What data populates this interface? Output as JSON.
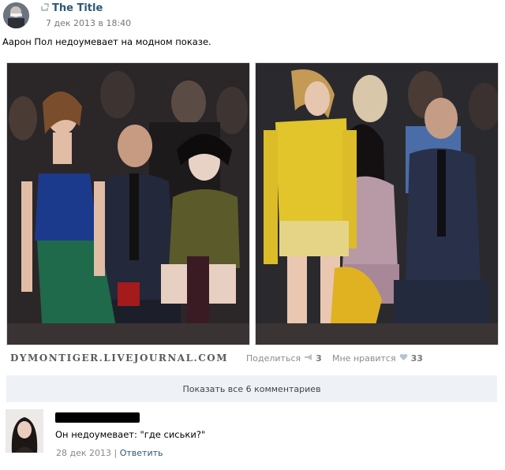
{
  "post": {
    "title": "The Title",
    "date": "7 дек 2013 в 18:40",
    "text": "Аарон Пол недоумевает на модном показе."
  },
  "watermark": "DYMONTIGER.LIVEJOURNAL.COM",
  "actions": {
    "share_label": "Поделиться",
    "share_count": "3",
    "like_label": "Мне нравится",
    "like_count": "33"
  },
  "comments_button": "Показать все 6 комментариев",
  "comment": {
    "text": "Он недоумевает: \"где сиськи?\"",
    "date": "28 дек 2013",
    "separator": "|",
    "reply_label": "Ответить"
  },
  "icons": {
    "post_type": "repost-icon",
    "share": "megaphone-icon",
    "like": "heart-icon"
  }
}
